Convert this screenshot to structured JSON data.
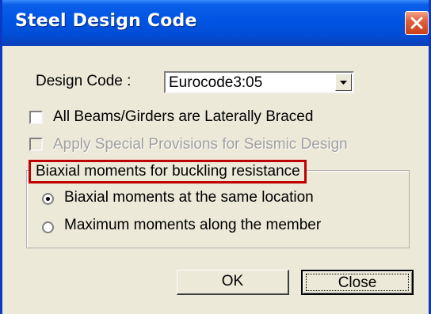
{
  "dialog": {
    "title": "Steel Design Code",
    "design_code_label": "Design Code :",
    "design_code_value": "Eurocode3:05",
    "braced_label": "All Beams/Girders are Laterally Braced",
    "braced_checked": false,
    "seismic_label": "Apply Special Provisions for Seismic Design",
    "seismic_enabled": false,
    "group_title": "Biaxial moments for buckling resistance",
    "options": [
      {
        "label": "Biaxial moments at the same location",
        "selected": true
      },
      {
        "label": "Maximum moments along the member",
        "selected": false
      }
    ],
    "ok_label": "OK",
    "close_label": "Close"
  },
  "colors": {
    "titlebar": "#0054e3",
    "highlight_border": "#c00000",
    "dialog_bg": "#ece9d8"
  }
}
